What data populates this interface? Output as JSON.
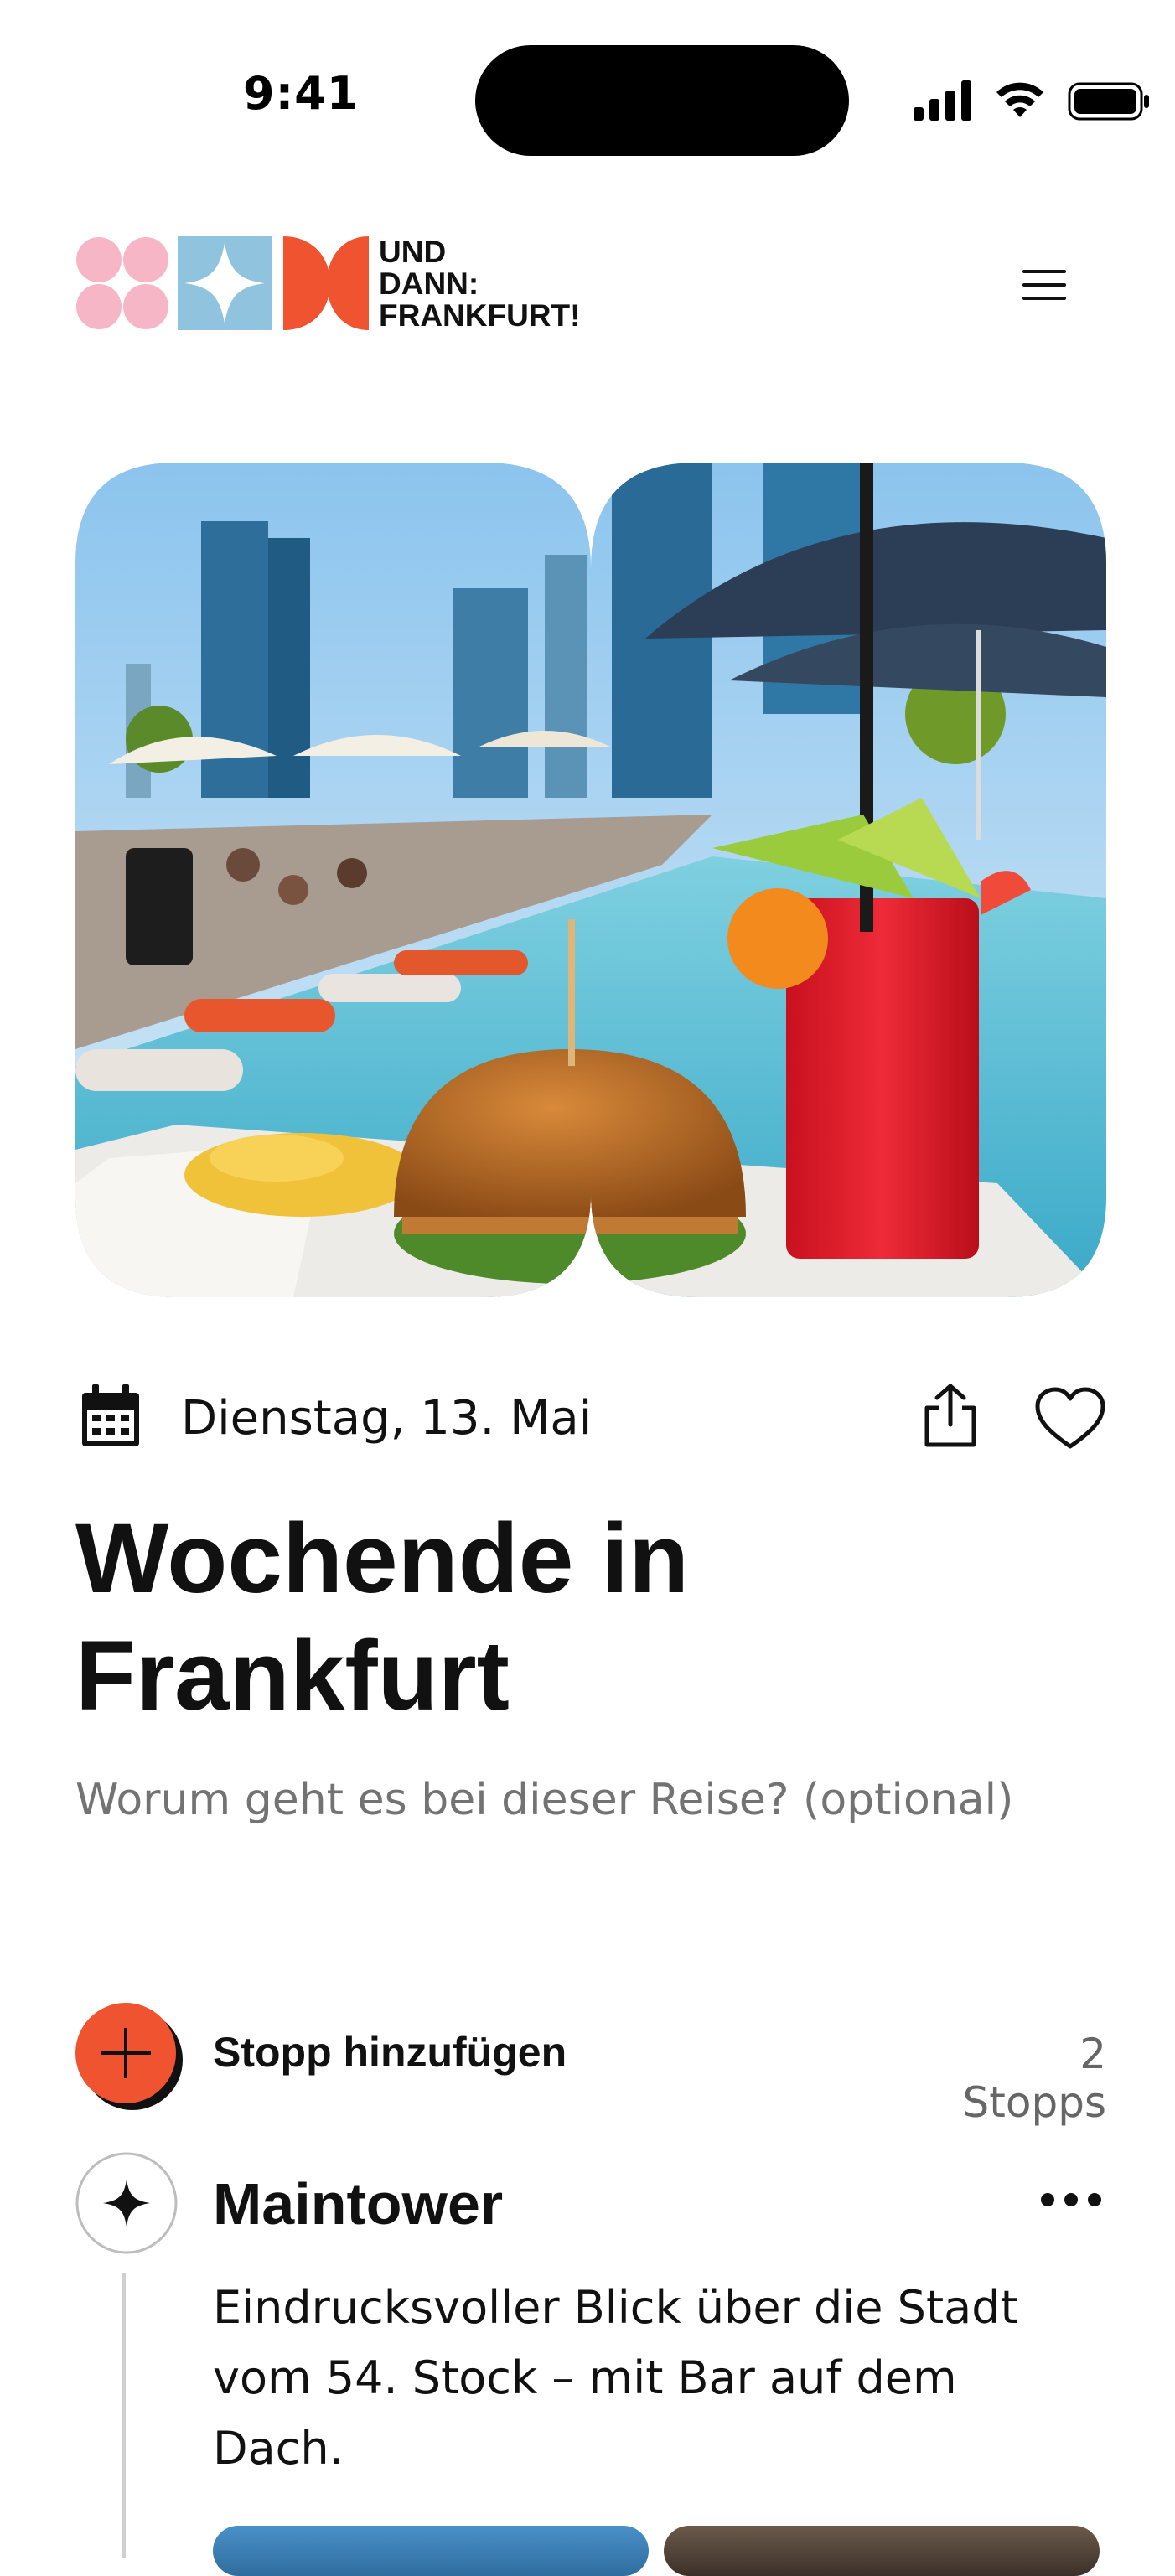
{
  "status_bar": {
    "time": "9:41"
  },
  "header": {
    "logo_text": [
      "UND",
      "DANN:",
      "FRANKFURT!"
    ],
    "menu_icon": "hamburger-menu-icon"
  },
  "hero": {
    "alt": "Rooftop pool with burger, fries and red cocktail in front of Frankfurt skyline"
  },
  "trip": {
    "date": "Dienstag, 13. Mai",
    "title_line1": "Wochende in",
    "title_line2": "Frankfurt",
    "description_placeholder": "Worum geht es bei dieser Reise? (optional)"
  },
  "stops": {
    "add_label": "Stopp hinzufügen",
    "count_label": "2 Stopps",
    "items": [
      {
        "name": "Maintower",
        "description": "Eindrucksvoller Blick über die Stadt vom 54. Stock – mit Bar auf dem Dach."
      }
    ]
  },
  "colors": {
    "accent": "#F0532F",
    "logo_pink": "#F7B6C6",
    "logo_blue": "#8FC3DE",
    "text": "#111111",
    "muted": "#737373"
  }
}
